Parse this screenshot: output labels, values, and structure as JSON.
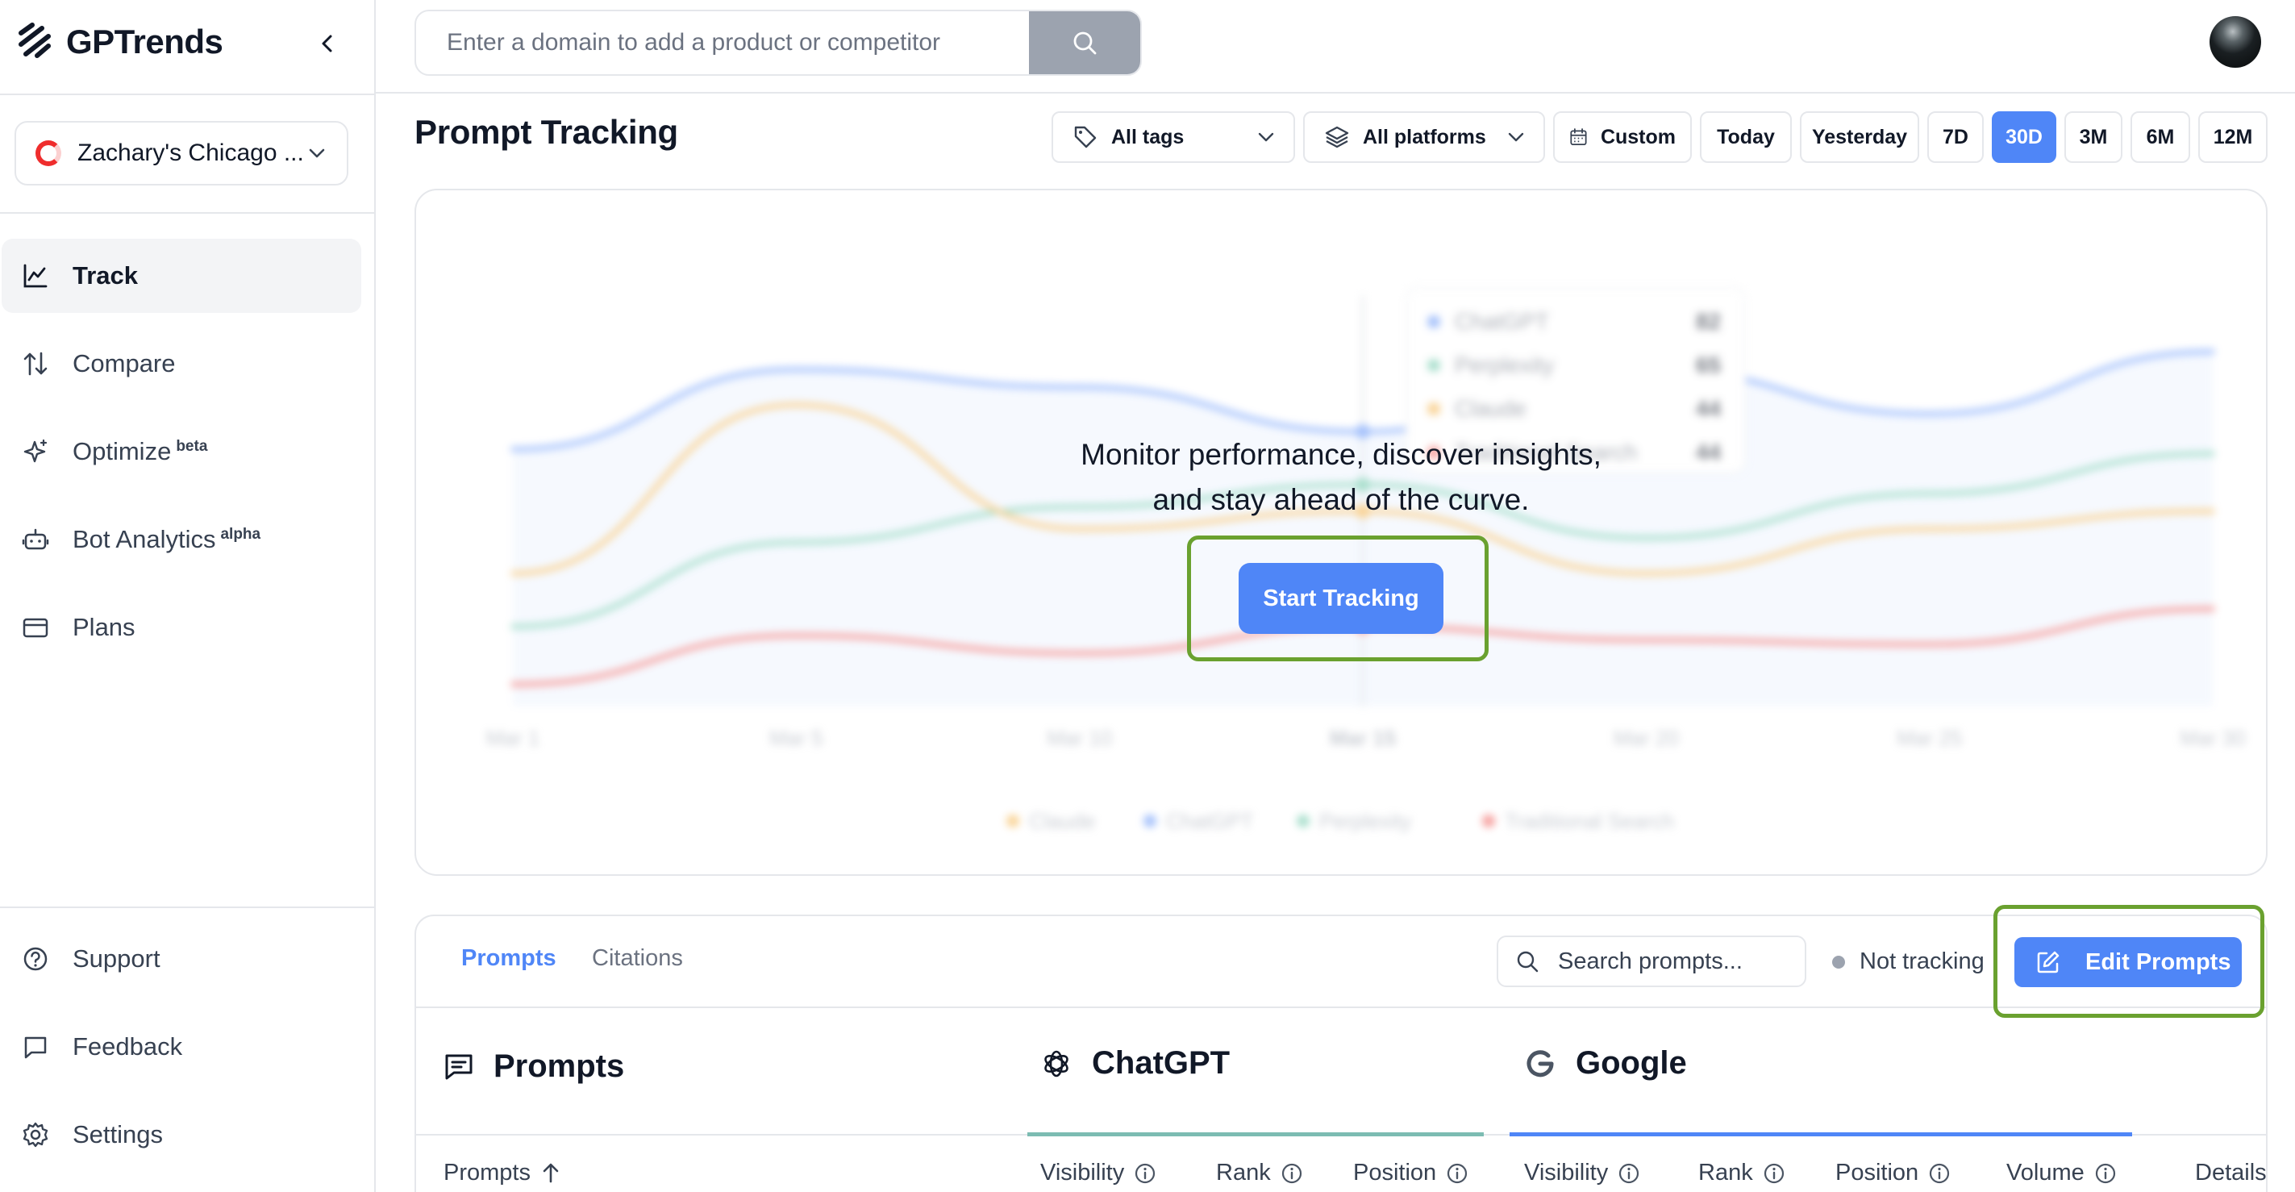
{
  "brand": {
    "name": "GPTrends"
  },
  "workspace": {
    "name": "Zachary's Chicago ..."
  },
  "nav": [
    {
      "label": "Track",
      "badge": "",
      "icon": "line-chart-icon"
    },
    {
      "label": "Compare",
      "badge": "",
      "icon": "arrows-up-down-icon"
    },
    {
      "label": "Optimize",
      "badge": "beta",
      "icon": "sparkles-icon"
    },
    {
      "label": "Bot Analytics",
      "badge": "alpha",
      "icon": "bot-icon"
    },
    {
      "label": "Plans",
      "badge": "",
      "icon": "credit-card-icon"
    }
  ],
  "footer_nav": [
    {
      "label": "Support",
      "icon": "help-circle-icon"
    },
    {
      "label": "Feedback",
      "icon": "message-square-icon"
    },
    {
      "label": "Settings",
      "icon": "gear-icon"
    }
  ],
  "topbar": {
    "search_placeholder": "Enter a domain to add a product or competitor"
  },
  "page": {
    "title": "Prompt Tracking"
  },
  "filters": {
    "tags": "All tags",
    "platforms": "All platforms",
    "custom": "Custom",
    "ranges": [
      "Today",
      "Yesterday",
      "7D",
      "30D",
      "3M",
      "6M",
      "12M"
    ],
    "selected_range": "30D"
  },
  "overlay": {
    "line1": "Monitor performance, discover insights,",
    "line2": "and stay ahead of the curve.",
    "cta": "Start Tracking"
  },
  "colors": {
    "accent": "#4f86f7",
    "chatgpt": "#5b8ff9",
    "perplexity": "#63c5a4",
    "claude": "#f5b041",
    "traditional_search": "#ef5350",
    "highlight": "#6aa12f"
  },
  "chart_data": {
    "type": "line",
    "x": [
      "Mar 1",
      "Mar 5",
      "Mar 10",
      "Mar 15",
      "Mar 20",
      "Mar 25",
      "Mar 30"
    ],
    "series": [
      {
        "name": "ChatGPT",
        "values": [
          58,
          76,
          72,
          62,
          76,
          66,
          80
        ]
      },
      {
        "name": "Perplexity",
        "values": [
          18,
          37,
          45,
          50,
          38,
          48,
          57
        ]
      },
      {
        "name": "Claude",
        "values": [
          30,
          68,
          40,
          44,
          30,
          40,
          44
        ]
      },
      {
        "name": "Traditional Search",
        "values": [
          5,
          16,
          12,
          18,
          15,
          14,
          22
        ]
      }
    ],
    "tooltip": {
      "x": "Mar 15",
      "items": [
        {
          "name": "ChatGPT",
          "value": "82"
        },
        {
          "name": "Perplexity",
          "value": "65"
        },
        {
          "name": "Claude",
          "value": "44"
        },
        {
          "name": "Traditional Search",
          "value": "44"
        }
      ]
    },
    "legend": [
      "Claude",
      "ChatGPT",
      "Perplexity",
      "Traditional Search"
    ],
    "legend_position": "bottom",
    "ylim": [
      0,
      100
    ],
    "grid": false
  },
  "table": {
    "tabs": [
      "Prompts",
      "Citations"
    ],
    "active_tab": "Prompts",
    "search_placeholder": "Search prompts...",
    "status": "Not tracking",
    "edit_label": "Edit Prompts",
    "sections": {
      "prompts": "Prompts",
      "chatgpt": "ChatGPT",
      "google": "Google"
    },
    "columns": {
      "prompts": "Prompts",
      "chatgpt": [
        "Visibility",
        "Rank",
        "Position"
      ],
      "google": [
        "Visibility",
        "Rank",
        "Position",
        "Volume"
      ],
      "details": "Details"
    }
  }
}
